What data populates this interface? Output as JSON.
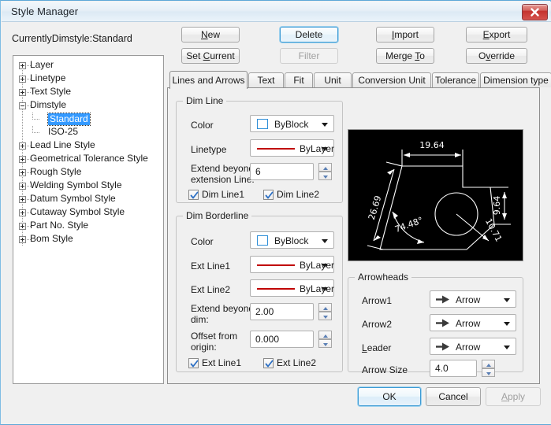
{
  "window": {
    "title": "Style Manager",
    "close_icon": "close-icon"
  },
  "current_style_label": "CurrentlyDimstyle:Standard",
  "tree": {
    "items": [
      {
        "label": "Layer",
        "expander": "plus",
        "depth": 0
      },
      {
        "label": "Linetype",
        "expander": "plus",
        "depth": 0
      },
      {
        "label": "Text Style",
        "expander": "plus",
        "depth": 0
      },
      {
        "label": "Dimstyle",
        "expander": "minus",
        "depth": 0
      },
      {
        "label": "Standard",
        "expander": "none",
        "depth": 1,
        "selected": true
      },
      {
        "label": "ISO-25",
        "expander": "none",
        "depth": 1,
        "selected": false
      },
      {
        "label": "Lead Line Style",
        "expander": "plus",
        "depth": 0
      },
      {
        "label": "Geometrical Tolerance Style",
        "expander": "plus",
        "depth": 0
      },
      {
        "label": "Rough Style",
        "expander": "plus",
        "depth": 0
      },
      {
        "label": "Welding Symbol Style",
        "expander": "plus",
        "depth": 0
      },
      {
        "label": "Datum Symbol Style",
        "expander": "plus",
        "depth": 0
      },
      {
        "label": "Cutaway Symbol Style",
        "expander": "plus",
        "depth": 0
      },
      {
        "label": "Part No. Style",
        "expander": "plus",
        "depth": 0
      },
      {
        "label": "Bom Style",
        "expander": "plus",
        "depth": 0
      }
    ]
  },
  "action_buttons": [
    {
      "label": "New",
      "accel": "N",
      "state": "normal"
    },
    {
      "label": "Set Current",
      "accel": "C",
      "state": "normal"
    },
    {
      "label": "Delete",
      "accel": "",
      "state": "focused"
    },
    {
      "label": "Filter",
      "accel": "",
      "state": "disabled"
    },
    {
      "label": "Import",
      "accel": "I",
      "state": "normal"
    },
    {
      "label": "Merge To",
      "accel": "T",
      "state": "normal"
    },
    {
      "label": "Export",
      "accel": "E",
      "state": "normal"
    },
    {
      "label": "Override",
      "accel": "v",
      "state": "normal"
    }
  ],
  "tabs": [
    {
      "label": "Lines and Arrows",
      "active": true
    },
    {
      "label": "Text",
      "active": false
    },
    {
      "label": "Fit",
      "active": false
    },
    {
      "label": "Unit",
      "active": false
    },
    {
      "label": "Conversion Unit",
      "active": false
    },
    {
      "label": "Tolerance",
      "active": false
    },
    {
      "label": "Dimension type",
      "active": false
    }
  ],
  "dim_line": {
    "title": "Dim Line",
    "color_label": "Color",
    "color_value": "ByBlock",
    "linetype_label": "Linetype",
    "linetype_value": "ByLayer",
    "extend_label": "Extend beyond",
    "extend_label2": "extension Line:",
    "extend_value": "6",
    "check1_label": "Dim Line1",
    "check1_checked": true,
    "check2_label": "Dim Line2",
    "check2_checked": true
  },
  "dim_borderline": {
    "title": "Dim Borderline",
    "color_label": "Color",
    "color_value": "ByBlock",
    "ext1_label": "Ext Line1",
    "ext1_value": "ByLayer",
    "ext2_label": "Ext Line2",
    "ext2_value": "ByLayer",
    "extend_label": "Extend beyond",
    "extend_label2": "dim:",
    "extend_value": "2.00",
    "offset_label": "Offset from",
    "offset_label2": "origin:",
    "offset_value": "0.000",
    "check1_label": "Ext Line1",
    "check1_checked": true,
    "check2_label": "Ext Line2",
    "check2_checked": true
  },
  "arrowheads": {
    "title": "Arrowheads",
    "arrow1_label": "Arrow1",
    "arrow1_value": "Arrow",
    "arrow2_label": "Arrow2",
    "arrow2_value": "Arrow",
    "leader_label": "Leader",
    "leader_accel": "L",
    "leader_value": "Arrow",
    "size_label": "Arrow Size",
    "size_value": "4.0"
  },
  "preview": {
    "dim_top": "19.64",
    "dim_right": "9.64",
    "dim_left": "26.69",
    "dim_angle": "74.48°",
    "dim_diameter": "10.71",
    "background": "#000000",
    "stroke": "#ffffff"
  },
  "dialog_buttons": [
    {
      "label": "OK",
      "accel": "",
      "state": "default"
    },
    {
      "label": "Cancel",
      "accel": "",
      "state": "normal"
    },
    {
      "label": "Apply",
      "accel": "A",
      "state": "disabled"
    }
  ],
  "colors": {
    "accent": "#3399ff",
    "window_border": "#5da8d8",
    "face": "#f0f0f0",
    "red_line": "#c00000",
    "swatch_border": "#2f8fd8"
  }
}
